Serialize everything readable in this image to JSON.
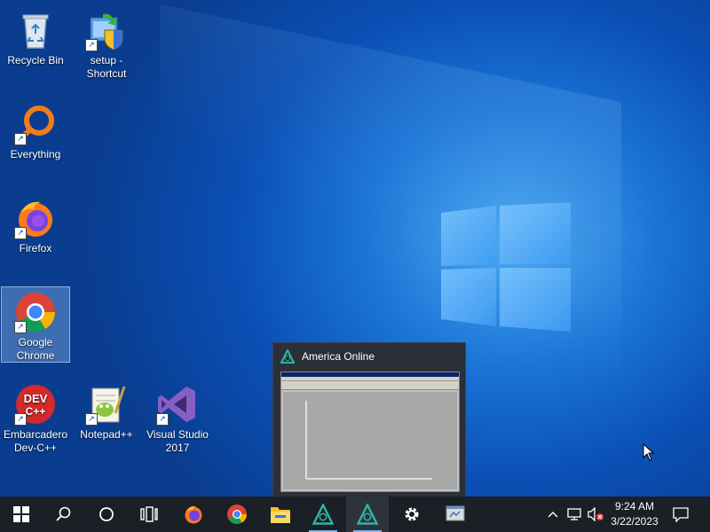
{
  "desktop": {
    "icons": [
      {
        "label": "Recycle Bin",
        "icon": "recycle-bin-icon"
      },
      {
        "label": "setup - Shortcut",
        "icon": "setup-icon"
      },
      {
        "label": "Everything",
        "icon": "everything-icon"
      },
      {
        "label": "Firefox",
        "icon": "firefox-icon"
      },
      {
        "label": "Google Chrome",
        "icon": "chrome-icon"
      },
      {
        "label": "Embarcadero Dev-C++",
        "icon": "devcpp-icon"
      },
      {
        "label": "Notepad++",
        "icon": "notepadpp-icon"
      },
      {
        "label": "Visual Studio 2017",
        "icon": "visual-studio-icon"
      }
    ],
    "selected_icon": "Google Chrome"
  },
  "preview": {
    "title": "America  Online",
    "icon": "aol-icon"
  },
  "taskbar": {
    "buttons": [
      {
        "name": "start",
        "icon": "windows-start-icon"
      },
      {
        "name": "search",
        "icon": "search-icon"
      },
      {
        "name": "cortana",
        "icon": "cortana-circle-icon"
      },
      {
        "name": "task-view",
        "icon": "task-view-icon"
      },
      {
        "name": "firefox",
        "icon": "firefox-icon"
      },
      {
        "name": "chrome",
        "icon": "chrome-icon"
      },
      {
        "name": "file-explorer",
        "icon": "folder-icon"
      },
      {
        "name": "aol-1",
        "icon": "aol-icon"
      },
      {
        "name": "aol-2",
        "icon": "aol-icon"
      },
      {
        "name": "settings",
        "icon": "gear-icon"
      },
      {
        "name": "app",
        "icon": "app-window-icon"
      }
    ],
    "tray": {
      "time": "9:24 AM",
      "date": "3/22/2023"
    }
  },
  "colors": {
    "taskbar": "#1b1f26",
    "desktop_accent": "#1a74d6",
    "active_indicator": "#7fb3e8"
  }
}
